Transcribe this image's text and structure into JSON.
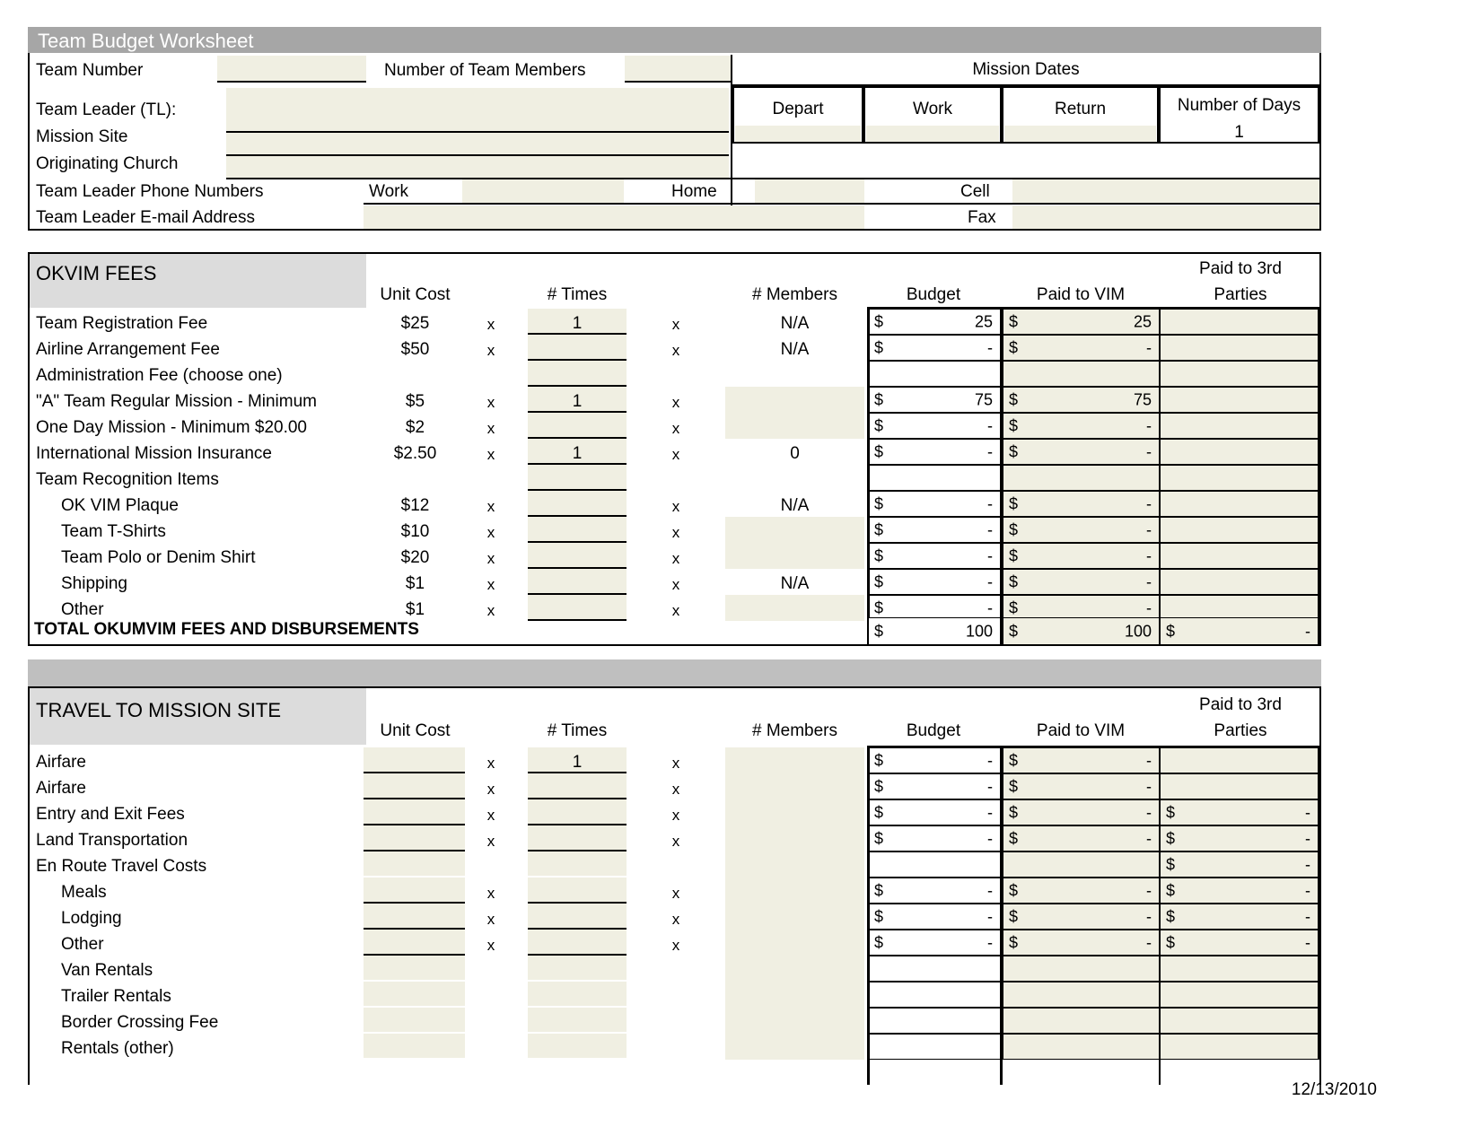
{
  "document": {
    "title": "Team Budget Worksheet",
    "footer_date": "12/13/2010"
  },
  "header": {
    "fields": {
      "team_number_label": "Team Number",
      "team_number_value": "",
      "num_members_label": "Number of Team Members",
      "num_members_value": "",
      "team_leader_label": "Team Leader (TL):",
      "team_leader_value": "",
      "mission_site_label": "Mission Site",
      "mission_site_value": "",
      "originating_church_label": "Originating Church",
      "originating_church_value": "",
      "phone_label": "Team Leader Phone Numbers",
      "work_label": "Work",
      "work_value": "",
      "home_label": "Home",
      "home_value": "",
      "cell_label": "Cell",
      "cell_value": "",
      "email_label": "Team Leader E-mail Address",
      "email_value": "",
      "fax_label": "Fax",
      "fax_value": ""
    },
    "mission_dates": {
      "title": "Mission  Dates",
      "columns": [
        "Depart",
        "Work",
        "Return",
        "Number of Days"
      ],
      "values": [
        "",
        "",
        "",
        "1"
      ]
    }
  },
  "okvim": {
    "section_title": "OKVIM FEES",
    "columns": {
      "unit_cost": "Unit Cost",
      "times": "# Times",
      "members": "# Members",
      "budget": "Budget",
      "paid_to_vim": "Paid to VIM",
      "paid_to_third": "Paid to 3rd",
      "paid_to_third2": "Parties"
    },
    "operator": "x",
    "rows": [
      {
        "label": "Team Registration Fee",
        "indent": 0,
        "unit_cost": "$25",
        "times": "1",
        "members": "N/A",
        "members_kind": "text",
        "budget": "25",
        "paid_vim": "25",
        "third": "",
        "has_money": true,
        "has_third": false
      },
      {
        "label": "Airline Arrangement Fee",
        "indent": 0,
        "unit_cost": "$50",
        "times": "",
        "members": "N/A",
        "members_kind": "text",
        "budget": "-",
        "paid_vim": "-",
        "third": "",
        "has_money": true,
        "has_third": false
      },
      {
        "label": "Administration Fee (choose one)",
        "indent": 0,
        "unit_cost": "",
        "times": "",
        "members": "",
        "members_kind": "none",
        "budget": "",
        "paid_vim": "",
        "third": "",
        "has_money": false,
        "has_third": false
      },
      {
        "label": "\"A\" Team Regular   Mission - Minimum",
        "indent": 0,
        "unit_cost": "$5",
        "times": "1",
        "members": "",
        "members_kind": "fill",
        "budget": "75",
        "paid_vim": "75",
        "third": "",
        "has_money": true,
        "has_third": false
      },
      {
        "label": " One Day Mission - Minimum $20.00",
        "indent": 0,
        "unit_cost": "$2",
        "times": "",
        "members": "",
        "members_kind": "fill",
        "budget": "-",
        "paid_vim": "-",
        "third": "",
        "has_money": true,
        "has_third": false
      },
      {
        "label": "International Mission Insurance",
        "indent": 0,
        "unit_cost": "$2.50",
        "times": "1",
        "members": "0",
        "members_kind": "text",
        "budget": "-",
        "paid_vim": "-",
        "third": "",
        "has_money": true,
        "has_third": false
      },
      {
        "label": "Team Recognition Items",
        "indent": 0,
        "unit_cost": "",
        "times": "",
        "members": "",
        "members_kind": "none",
        "budget": "",
        "paid_vim": "",
        "third": "",
        "has_money": false,
        "has_third": false
      },
      {
        "label": "OK VIM Plaque",
        "indent": 1,
        "unit_cost": "$12",
        "times": "",
        "members": "N/A",
        "members_kind": "text",
        "budget": "-",
        "paid_vim": "-",
        "third": "",
        "has_money": true,
        "has_third": false
      },
      {
        "label": "Team T-Shirts",
        "indent": 1,
        "unit_cost": "$10",
        "times": "",
        "members": "",
        "members_kind": "fill",
        "budget": "-",
        "paid_vim": "-",
        "third": "",
        "has_money": true,
        "has_third": false
      },
      {
        "label": "Team Polo or Denim Shirt",
        "indent": 1,
        "unit_cost": "$20",
        "times": "",
        "members": "",
        "members_kind": "fill",
        "budget": "-",
        "paid_vim": "-",
        "third": "",
        "has_money": true,
        "has_third": false
      },
      {
        "label": "Shipping",
        "indent": 1,
        "unit_cost": "$1",
        "times": "",
        "members": "N/A",
        "members_kind": "text",
        "budget": "-",
        "paid_vim": "-",
        "third": "",
        "has_money": true,
        "has_third": false
      },
      {
        "label": "Other",
        "indent": 1,
        "unit_cost": "$1",
        "times": "",
        "members": "",
        "members_kind": "fill",
        "budget": "-",
        "paid_vim": "-",
        "third": "",
        "has_money": true,
        "has_third": false
      }
    ],
    "total": {
      "label": "TOTAL OKUMVIM FEES AND DISBURSEMENTS",
      "budget": "100",
      "paid_vim": "100",
      "third": "-"
    }
  },
  "travel": {
    "section_title": "TRAVEL TO MISSION SITE",
    "columns": {
      "unit_cost": "Unit Cost",
      "times": "# Times",
      "members": "# Members",
      "budget": "Budget",
      "paid_to_vim": "Paid to VIM",
      "paid_to_third": "Paid to 3rd",
      "paid_to_third2": "Parties"
    },
    "operator": "x",
    "rows": [
      {
        "label": "Airfare",
        "indent": 0,
        "unit_cost": "",
        "times": "1",
        "has_ops": true,
        "budget": "-",
        "paid_vim": "-",
        "third": "",
        "has_money": true,
        "has_third": false
      },
      {
        "label": "Airfare",
        "indent": 0,
        "unit_cost": "",
        "times": "",
        "has_ops": true,
        "budget": "-",
        "paid_vim": "-",
        "third": "",
        "has_money": true,
        "has_third": false
      },
      {
        "label": "Entry and Exit Fees",
        "indent": 0,
        "unit_cost": "",
        "times": "",
        "has_ops": true,
        "budget": "-",
        "paid_vim": "-",
        "third": "-",
        "has_money": true,
        "has_third": true
      },
      {
        "label": "Land Transportation",
        "indent": 0,
        "unit_cost": "",
        "times": "",
        "has_ops": true,
        "budget": "-",
        "paid_vim": "-",
        "third": "-",
        "has_money": true,
        "has_third": true
      },
      {
        "label": "En Route Travel Costs",
        "indent": 0,
        "unit_cost": "",
        "times": "",
        "has_ops": false,
        "budget": "",
        "paid_vim": "",
        "third": "-",
        "has_money": false,
        "has_third": true
      },
      {
        "label": "Meals",
        "indent": 1,
        "unit_cost": "",
        "times": "",
        "has_ops": true,
        "budget": "-",
        "paid_vim": "-",
        "third": "-",
        "has_money": true,
        "has_third": true
      },
      {
        "label": "Lodging",
        "indent": 1,
        "unit_cost": "",
        "times": "",
        "has_ops": true,
        "budget": "-",
        "paid_vim": "-",
        "third": "-",
        "has_money": true,
        "has_third": true
      },
      {
        "label": "Other",
        "indent": 1,
        "unit_cost": "",
        "times": "",
        "has_ops": true,
        "budget": "-",
        "paid_vim": "-",
        "third": "-",
        "has_money": true,
        "has_third": true
      },
      {
        "label": "Van Rentals",
        "indent": 1,
        "unit_cost": "",
        "times": "",
        "has_ops": false,
        "budget": "",
        "paid_vim": "",
        "third": "",
        "has_money": false,
        "has_third": false
      },
      {
        "label": "Trailer Rentals",
        "indent": 1,
        "unit_cost": "",
        "times": "",
        "has_ops": false,
        "budget": "",
        "paid_vim": "",
        "third": "",
        "has_money": false,
        "has_third": false
      },
      {
        "label": "Border Crossing Fee",
        "indent": 1,
        "unit_cost": "",
        "times": "",
        "has_ops": false,
        "budget": "",
        "paid_vim": "",
        "third": "",
        "has_money": false,
        "has_third": false
      },
      {
        "label": "Rentals (other)",
        "indent": 1,
        "unit_cost": "",
        "times": "",
        "has_ops": false,
        "budget": "",
        "paid_vim": "",
        "third": "",
        "has_money": false,
        "has_third": false
      }
    ]
  },
  "colors": {
    "title_bar": "#a6a6a6",
    "section_header": "#dcdcdc",
    "band": "#bfbfbf",
    "input_fill": "#f0efe2",
    "page": "#ffffff"
  }
}
